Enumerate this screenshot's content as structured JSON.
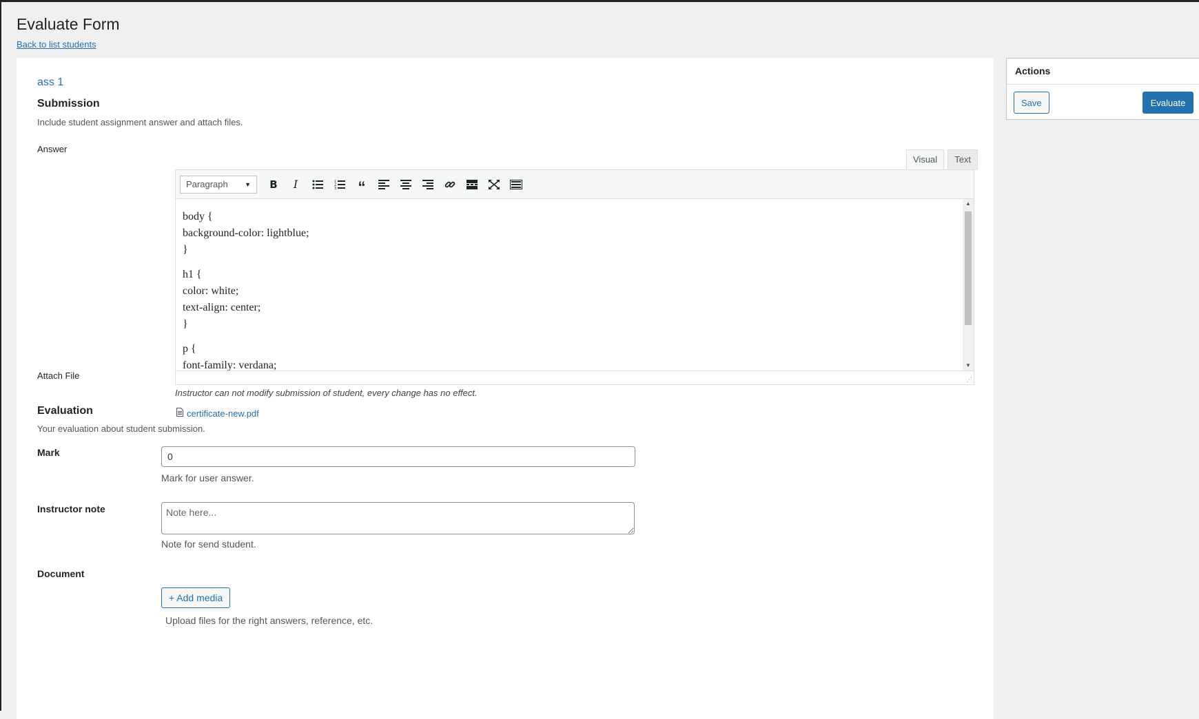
{
  "page": {
    "title": "Evaluate Form",
    "back_link": "Back to list students"
  },
  "assignment": {
    "title": "ass 1"
  },
  "submission": {
    "heading": "Submission",
    "description": "Include student assignment answer and attach files.",
    "answer_label": "Answer",
    "editor": {
      "tabs": [
        "Visual",
        "Text"
      ],
      "active_tab": "Visual",
      "format_select": "Paragraph",
      "toolbar_icons": [
        "bold-icon",
        "italic-icon",
        "bulleted-list-icon",
        "numbered-list-icon",
        "blockquote-icon",
        "align-left-icon",
        "align-center-icon",
        "align-right-icon",
        "link-icon",
        "read-more-icon",
        "fullscreen-icon",
        "toolbar-toggle-icon"
      ],
      "content": [
        "body {\nbackground-color: lightblue;\n}",
        "h1 {\ncolor: white;\ntext-align: center;\n}",
        "p {\nfont-family: verdana;"
      ]
    },
    "editor_note": "Instructor can not modify submission of student, every change has no effect.",
    "attach_label": "Attach File",
    "attach_file": "certificate-new.pdf"
  },
  "evaluation": {
    "heading": "Evaluation",
    "description": "Your evaluation about student submission.",
    "mark_label": "Mark",
    "mark_value": "0",
    "mark_help": "Mark for user answer.",
    "note_label": "Instructor note",
    "note_placeholder": "Note here...",
    "note_help": "Note for send student.",
    "document_label": "Document",
    "add_media_button": "+ Add media",
    "document_help": "Upload files for the right answers, reference, etc."
  },
  "actions": {
    "heading": "Actions",
    "save_button": "Save",
    "evaluate_button": "Evaluate"
  },
  "colors": {
    "link": "#2271b1",
    "primary_button": "#2271b1",
    "background": "#f0f0f1"
  }
}
